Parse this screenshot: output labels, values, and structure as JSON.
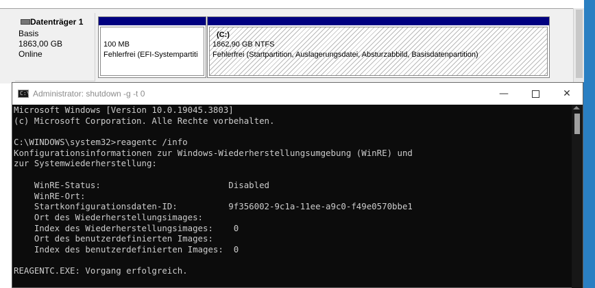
{
  "disk": {
    "name": "Datenträger 1",
    "type": "Basis",
    "size": "1863,00 GB",
    "status": "Online"
  },
  "partitions": [
    {
      "name": "",
      "size": "100 MB",
      "status": "Fehlerfrei (EFI-Systempartiti"
    },
    {
      "name": "(C:)",
      "size": "1862,90 GB NTFS",
      "status": "Fehlerfrei (Startpartition, Auslagerungsdatei, Absturzabbild, Basisdatenpartition)"
    }
  ],
  "cmd": {
    "title": "Administrator: shutdown -g -t 0",
    "icon_text": "C:\\",
    "controls": {
      "minimize": "—",
      "maximize": "",
      "close": "✕"
    },
    "lines": [
      "Microsoft Windows [Version 10.0.19045.3803]",
      "(c) Microsoft Corporation. Alle Rechte vorbehalten.",
      "",
      "C:\\WINDOWS\\system32>reagentc /info",
      "Konfigurationsinformationen zur Windows-Wiederherstellungsumgebung (WinRE) und",
      "zur Systemwiederherstellung:",
      "",
      "    WinRE-Status:                         Disabled",
      "    WinRE-Ort:",
      "    Startkonfigurationsdaten-ID:          9f356002-9c1a-11ee-a9c0-f49e0570bbe1",
      "    Ort des Wiederherstellungsimages:",
      "    Index des Wiederherstellungsimages:    0",
      "    Ort des benutzerdefinierten Images:",
      "    Index des benutzerdefinierten Images:  0",
      "",
      "REAGENTC.EXE: Vorgang erfolgreich."
    ]
  },
  "colors": {
    "partition_header": "#000080",
    "console_bg": "#0c0c0c",
    "console_text": "#cccccc",
    "desktop_accent": "#2a7fc2"
  }
}
